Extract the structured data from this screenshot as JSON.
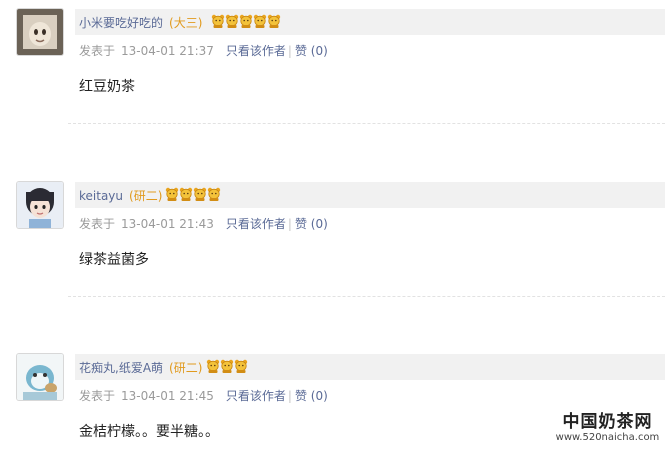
{
  "posts": [
    {
      "username": "小米要吃好吃的",
      "level": "(大三)",
      "badge_count": 5,
      "posted_prefix": "发表于",
      "timestamp": "13-04-01 21:37",
      "author_only": "只看该作者",
      "like_label": "赞 (0)",
      "content": "红豆奶茶"
    },
    {
      "username": "keitayu",
      "level": "(研二)",
      "badge_count": 4,
      "posted_prefix": "发表于",
      "timestamp": "13-04-01 21:43",
      "author_only": "只看该作者",
      "like_label": "赞 (0)",
      "content": "绿茶益菌多"
    },
    {
      "username": "花痴丸,纸爱A萌",
      "level": "(研二)",
      "badge_count": 3,
      "posted_prefix": "发表于",
      "timestamp": "13-04-01 21:45",
      "author_only": "只看该作者",
      "like_label": "赞 (0)",
      "content": "金桔柠檬。。要半糖。。"
    }
  ],
  "watermark": {
    "title": "中国奶茶网",
    "url": "www.520naicha.com"
  },
  "colors": {
    "username": "#5a6a96",
    "level": "#e19a1d",
    "meta": "#9a9a9a",
    "header_bar": "#f1f1f1"
  },
  "icons": {
    "badge": "bear-badge-icon"
  }
}
